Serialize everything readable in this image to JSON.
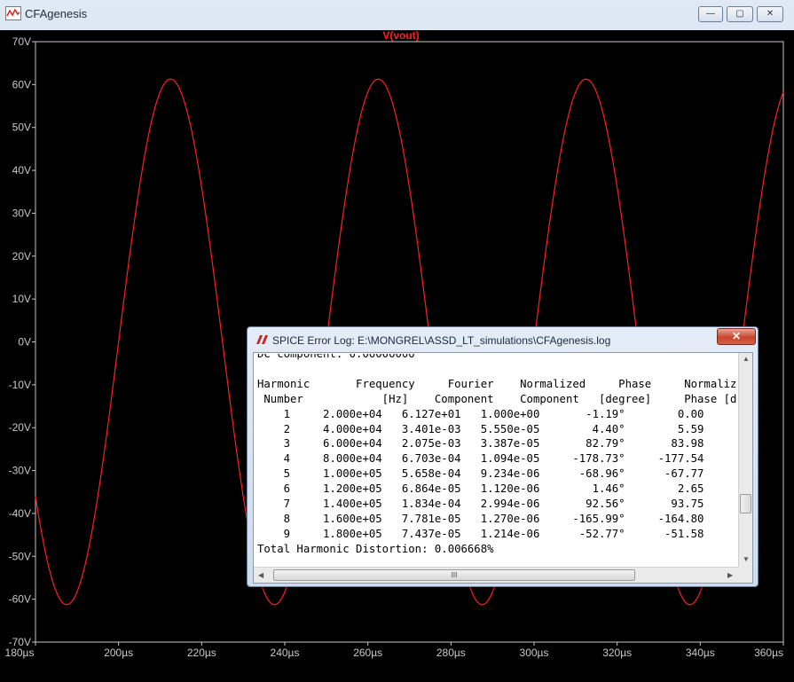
{
  "window": {
    "title": "CFAgenesis",
    "minimize_glyph": "—",
    "maximize_glyph": "▢",
    "close_glyph": "✕"
  },
  "chart_data": {
    "type": "line",
    "title": "V(vout)",
    "xlabel": "",
    "ylabel": "",
    "x_unit": "µs",
    "y_unit": "V",
    "xlim": [
      180,
      360
    ],
    "ylim": [
      -70,
      70
    ],
    "x_ticks": [
      "180µs",
      "200µs",
      "220µs",
      "240µs",
      "260µs",
      "280µs",
      "300µs",
      "320µs",
      "340µs",
      "360µs"
    ],
    "y_ticks": [
      "70V",
      "60V",
      "50V",
      "40V",
      "30V",
      "20V",
      "10V",
      "0V",
      "-10V",
      "-20V",
      "-30V",
      "-40V",
      "-50V",
      "-60V",
      "-70V"
    ],
    "grid": false,
    "colors": {
      "background": "#000000",
      "trace": "#ff1e1e",
      "title": "#ff1e1e",
      "ticks": "#c8c8c8"
    },
    "series": [
      {
        "name": "V(vout)",
        "waveform": "sine",
        "amplitude": 61.27,
        "frequency_khz": 20,
        "peak_time_us": 212.5,
        "x_start": 180,
        "x_end": 360
      }
    ]
  },
  "log_window": {
    "title": "SPICE Error Log: E:\\MONGREL\\ASSD_LT_simulations\\CFAgenesis.log",
    "close_glyph": "✕",
    "partial_line": "DC component: 0.00000000",
    "header1": [
      "Harmonic",
      "Frequency",
      "Fourier",
      "Normalized",
      "Phase",
      "Normaliz"
    ],
    "header2": [
      "Number",
      "[Hz]",
      "Component",
      "Component",
      "[degree]",
      "Phase [d"
    ],
    "rows": [
      [
        "1",
        "2.000e+04",
        "6.127e+01",
        "1.000e+00",
        "-1.19°",
        "0.00"
      ],
      [
        "2",
        "4.000e+04",
        "3.401e-03",
        "5.550e-05",
        "4.40°",
        "5.59"
      ],
      [
        "3",
        "6.000e+04",
        "2.075e-03",
        "3.387e-05",
        "82.79°",
        "83.98"
      ],
      [
        "4",
        "8.000e+04",
        "6.703e-04",
        "1.094e-05",
        "-178.73°",
        "-177.54"
      ],
      [
        "5",
        "1.000e+05",
        "5.658e-04",
        "9.234e-06",
        "-68.96°",
        "-67.77"
      ],
      [
        "6",
        "1.200e+05",
        "6.864e-05",
        "1.120e-06",
        "1.46°",
        "2.65"
      ],
      [
        "7",
        "1.400e+05",
        "1.834e-04",
        "2.994e-06",
        "92.56°",
        "93.75"
      ],
      [
        "8",
        "1.600e+05",
        "7.781e-05",
        "1.270e-06",
        "-165.99°",
        "-164.80"
      ],
      [
        "9",
        "1.800e+05",
        "7.437e-05",
        "1.214e-06",
        "-52.77°",
        "-51.58"
      ]
    ],
    "thd": "Total Harmonic Distortion: 0.006668%",
    "hscroll_grip": "III",
    "arrow_up": "▲",
    "arrow_down": "▼",
    "arrow_left": "◀",
    "arrow_right": "▶"
  }
}
